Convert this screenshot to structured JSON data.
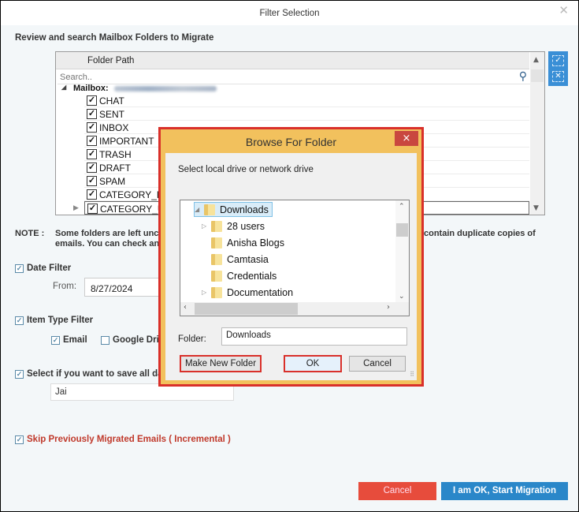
{
  "window": {
    "title": "Filter Selection",
    "close_icon": "close-x"
  },
  "folders_section": {
    "heading": "Review and search Mailbox Folders to Migrate",
    "column_header": "Folder Path",
    "search_placeholder": "Search..",
    "mailbox_label": "Mailbox:",
    "folders": [
      {
        "name": "CHAT",
        "checked": true
      },
      {
        "name": "SENT",
        "checked": true
      },
      {
        "name": "INBOX",
        "checked": true
      },
      {
        "name": "IMPORTANT",
        "checked": true
      },
      {
        "name": "TRASH",
        "checked": true
      },
      {
        "name": "DRAFT",
        "checked": true
      },
      {
        "name": "SPAM",
        "checked": true
      },
      {
        "name": "CATEGORY_FO",
        "checked": true
      },
      {
        "name": "CATEGORY_U",
        "checked": true
      }
    ],
    "side_buttons": {
      "select_all": "✓",
      "deselect_all": "✕"
    }
  },
  "note": {
    "label": "NOTE :",
    "line1_left": "Some folders are left unc",
    "line1_right": "contain duplicate copies of",
    "line2": "emails. You can check and"
  },
  "date_filter": {
    "label": "Date Filter",
    "checked": true,
    "from_label": "From:",
    "from_value": "8/27/2024"
  },
  "item_type_filter": {
    "label": "Item Type Filter",
    "checked": true,
    "email_label": "Email",
    "email_checked": true,
    "gdrive_label": "Google Driv",
    "gdrive_checked": false
  },
  "save_option": {
    "label": "Select if you want to save all dat",
    "checked": true,
    "value": "Jai"
  },
  "incremental": {
    "label": "Skip Previously Migrated Emails ( Incremental )",
    "checked": true,
    "color": "#c0392b"
  },
  "footer": {
    "cancel_label": "Cancel",
    "start_label": "I am OK, Start Migration"
  },
  "browse_dialog": {
    "title": "Browse For Folder",
    "close_label": "×",
    "prompt": "Select local drive or network drive",
    "tree": [
      {
        "name": "Downloads",
        "expanded": true,
        "selected": true,
        "has_children": true,
        "level": 0
      },
      {
        "name": "28 users",
        "has_children": true,
        "level": 1
      },
      {
        "name": "Anisha Blogs",
        "has_children": false,
        "level": 1
      },
      {
        "name": "Camtasia",
        "has_children": false,
        "level": 1
      },
      {
        "name": "Credentials",
        "has_children": false,
        "level": 1
      },
      {
        "name": "Documentation",
        "has_children": true,
        "level": 1
      }
    ],
    "folder_label": "Folder:",
    "folder_value": "Downloads",
    "make_new_folder_label": "Make New Folder",
    "ok_label": "OK",
    "cancel_label": "Cancel"
  }
}
